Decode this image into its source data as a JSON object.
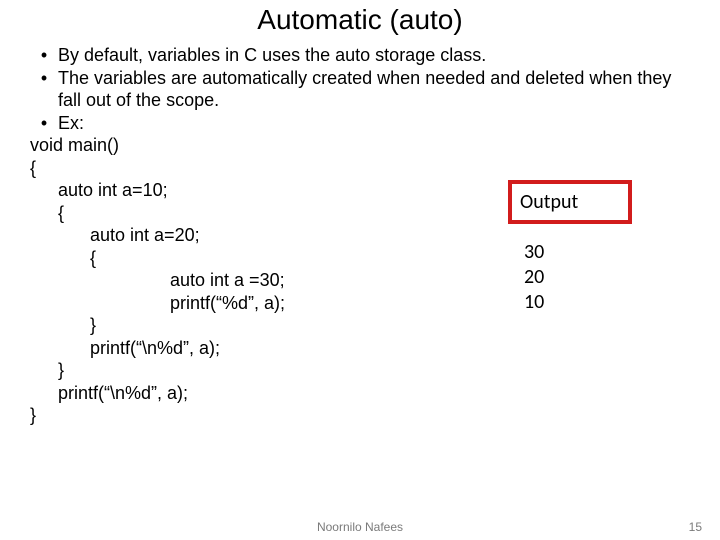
{
  "title": "Automatic (auto)",
  "bullets": [
    "By default, variables in C uses the auto storage class.",
    "The variables are automatically created when needed and deleted when they fall out of the scope.",
    "Ex:"
  ],
  "code": {
    "l01": "void main()",
    "l02": "{",
    "l03": "auto int a=10;",
    "l04": "{",
    "l05": "auto int a=20;",
    "l06": "{",
    "l07": "auto int a =30;",
    "l08": "printf(“%d”, a);",
    "l09": "}",
    "l10": "printf(“\\n%d”, a);",
    "l11": "}",
    "l12": "printf(“\\n%d”, a);",
    "l13": "}"
  },
  "output": {
    "label": "Output",
    "v1": "30",
    "v2": "20",
    "v3": "10"
  },
  "footer": {
    "author": "Noornilo Nafees",
    "page": "15"
  }
}
